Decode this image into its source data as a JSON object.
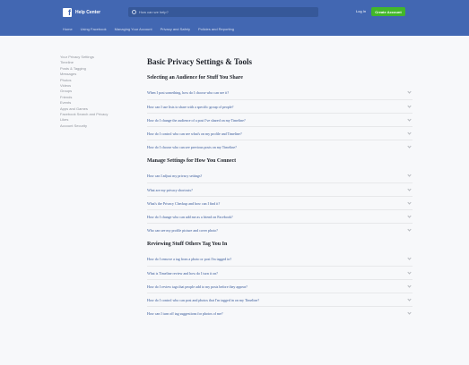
{
  "header": {
    "brand": "Help Center",
    "search_placeholder": "How can we help?",
    "login_label": "Log In",
    "create_label": "Create Account",
    "nav": [
      "Home",
      "Using Facebook",
      "Managing Your Account",
      "Privacy and Safety",
      "Policies and Reporting"
    ]
  },
  "sidebar": {
    "items": [
      "Your Privacy Settings",
      "Timeline",
      "Posts & Tagging",
      "Messages",
      "Photos",
      "Videos",
      "Groups",
      "Friends",
      "Events",
      "Apps and Games",
      "Facebook Search and Privacy",
      "Likes",
      "Account Security"
    ]
  },
  "main": {
    "title": "Basic Privacy Settings & Tools",
    "sections": [
      {
        "title": "Selecting an Audience for Stuff You Share",
        "questions": [
          "When I post something, how do I choose who can see it?",
          "How can I use lists to share with a specific group of people?",
          "How do I change the audience of a post I've shared on my Timeline?",
          "How do I control who can see what's on my profile and Timeline?",
          "How do I choose who can see previous posts on my Timeline?"
        ]
      },
      {
        "title": "Manage Settings for How You Connect",
        "questions": [
          "How can I adjust my privacy settings?",
          "What are my privacy shortcuts?",
          "What's the Privacy Checkup and how can I find it?",
          "How do I change who can add me as a friend on Facebook?",
          "Who can see my profile picture and cover photo?"
        ]
      },
      {
        "title": "Reviewing Stuff Others Tag You In",
        "questions": [
          "How do I remove a tag from a photo or post I'm tagged in?",
          "What is Timeline review and how do I turn it on?",
          "How do I review tags that people add to my posts before they appear?",
          "How do I control who can post and photos that I'm tagged in on my Timeline?",
          "How can I turn off tag suggestions for photos of me?"
        ]
      }
    ]
  }
}
